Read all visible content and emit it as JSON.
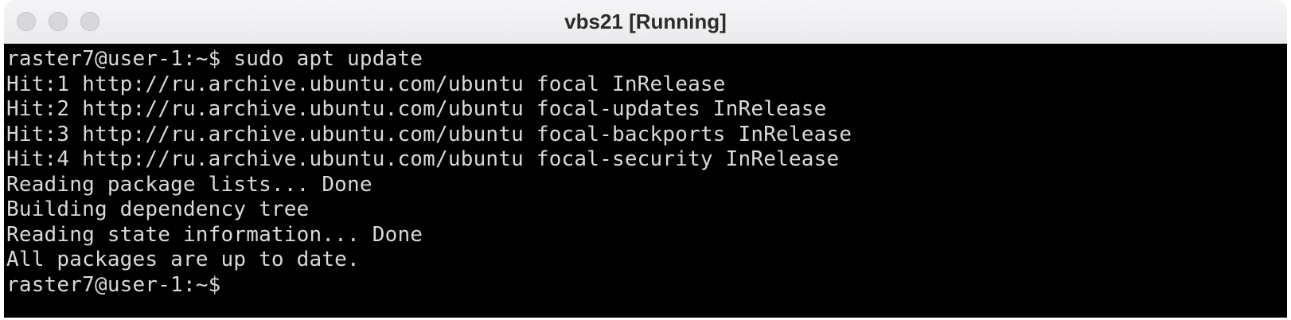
{
  "window": {
    "title": "vbs21 [Running]"
  },
  "terminal": {
    "lines": [
      "raster7@user-1:~$ sudo apt update",
      "Hit:1 http://ru.archive.ubuntu.com/ubuntu focal InRelease",
      "Hit:2 http://ru.archive.ubuntu.com/ubuntu focal-updates InRelease",
      "Hit:3 http://ru.archive.ubuntu.com/ubuntu focal-backports InRelease",
      "Hit:4 http://ru.archive.ubuntu.com/ubuntu focal-security InRelease",
      "Reading package lists... Done",
      "Building dependency tree",
      "Reading state information... Done",
      "All packages are up to date.",
      "raster7@user-1:~$"
    ]
  },
  "colors": {
    "terminal_bg": "#000000",
    "terminal_fg": "#d9d9d9",
    "titlebar_bg": "#f0eef1"
  },
  "icons": {
    "close": "close-icon",
    "minimize": "minimize-icon",
    "zoom": "zoom-icon"
  }
}
